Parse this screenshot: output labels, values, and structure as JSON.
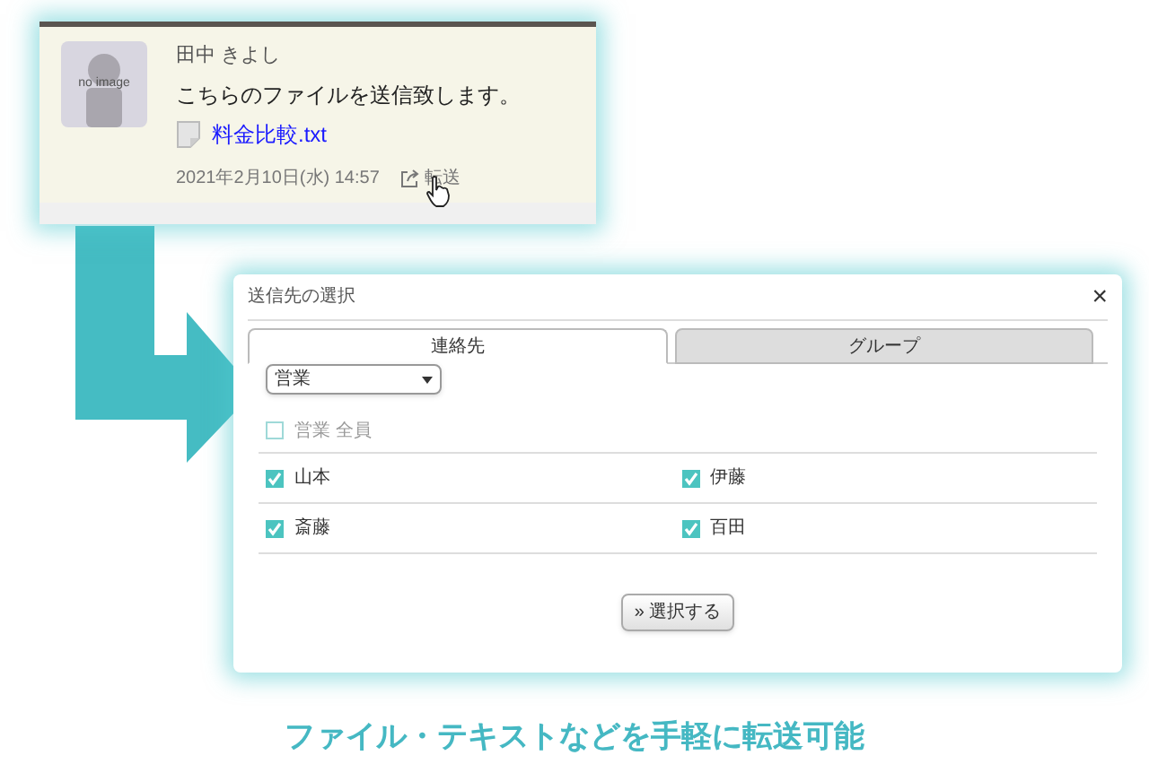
{
  "message": {
    "author": "田中 きよし",
    "avatar_label": "no image",
    "text": "こちらのファイルを送信致します。",
    "attachment": "料金比較.txt",
    "timestamp": "2021年2月10日(水) 14:57",
    "action": "転送"
  },
  "dialog": {
    "title": "送信先の選択",
    "close": "×",
    "tabs": [
      {
        "label": "連絡先",
        "selected": true
      },
      {
        "label": "グループ",
        "selected": false
      }
    ],
    "group_select": "営業",
    "select_all": {
      "label": "営業 全員",
      "checked": false
    },
    "members": [
      {
        "name": "山本",
        "checked": true
      },
      {
        "name": "伊藤",
        "checked": true
      },
      {
        "name": "斎藤",
        "checked": true
      },
      {
        "name": "百田",
        "checked": true
      }
    ],
    "button": "» 選択する"
  },
  "caption": "ファイル・テキストなどを手軽に転送可能"
}
